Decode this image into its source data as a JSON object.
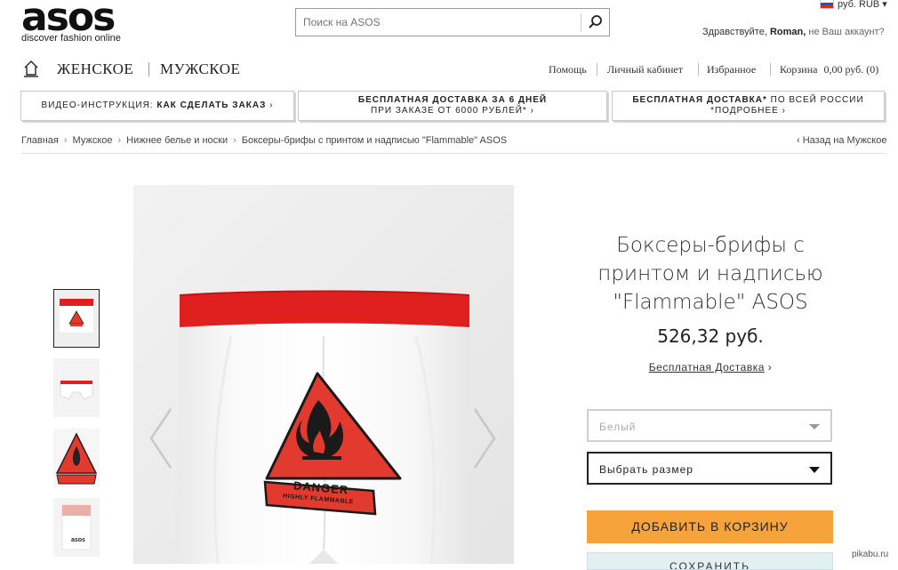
{
  "header": {
    "logo": "asos",
    "tagline": "discover fashion online",
    "search_placeholder": "Поиск на ASOS",
    "currency": "руб. RUB ▾",
    "greeting_prefix": "Здравствуйте,",
    "user_name": "Roman,",
    "greeting_suffix": "не Ваш аккаунт?"
  },
  "nav": {
    "women": "ЖЕНСКОЕ",
    "men": "МУЖСКОЕ",
    "help": "Помощь",
    "account": "Личный кабинет",
    "favorites": "Избранное",
    "cart_label": "Корзина",
    "cart_total": "0,00 руб. (0)"
  },
  "promos": [
    {
      "line1": "ВИДЕО-ИНСТРУКЦИЯ: ",
      "bold": "КАК СДЕЛАТЬ ЗАКАЗ",
      "tail": " ›"
    },
    {
      "line1": "БЕСПЛАТНАЯ ДОСТАВКА ЗА 6 ДНЕЙ",
      "line2": "ПРИ ЗАКАЗЕ ОТ 6000 РУБЛЕЙ* ›"
    },
    {
      "bold": "БЕСПЛАТНАЯ ДОСТАВКА*",
      "line1": " ПО ВСЕЙ РОССИИ",
      "line2": "*ПОДРОБНЕЕ ›"
    }
  ],
  "breadcrumb": {
    "items": [
      "Главная",
      "Мужское",
      "Нижнее белье и носки",
      "Боксеры-брифы с принтом и надписью \"Flammable\" ASOS"
    ],
    "separator": "›",
    "back": "‹  Назад на Мужское"
  },
  "product": {
    "title_lines": [
      "Боксеры-брифы с",
      "принтом и надписью",
      "\"Flammable\" ASOS"
    ],
    "price": "526,32 руб.",
    "free_delivery": "Бесплатная Доставка",
    "free_delivery_arrow": " ›",
    "color_value": "Белый",
    "size_placeholder": "Выбрать размер",
    "add_to_cart": "ДОБАВИТЬ В КОРЗИНУ",
    "save": "СОХРАНИТЬ",
    "print_text_1": "DANGER",
    "print_text_2": "HIGHLY FLAMMABLE",
    "thumb_brand": "asos"
  },
  "watermark": "pikabu.ru",
  "colors": {
    "accent_orange": "#f7a33b",
    "waistband_red": "#e0201f",
    "print_red": "#e23a2e"
  }
}
